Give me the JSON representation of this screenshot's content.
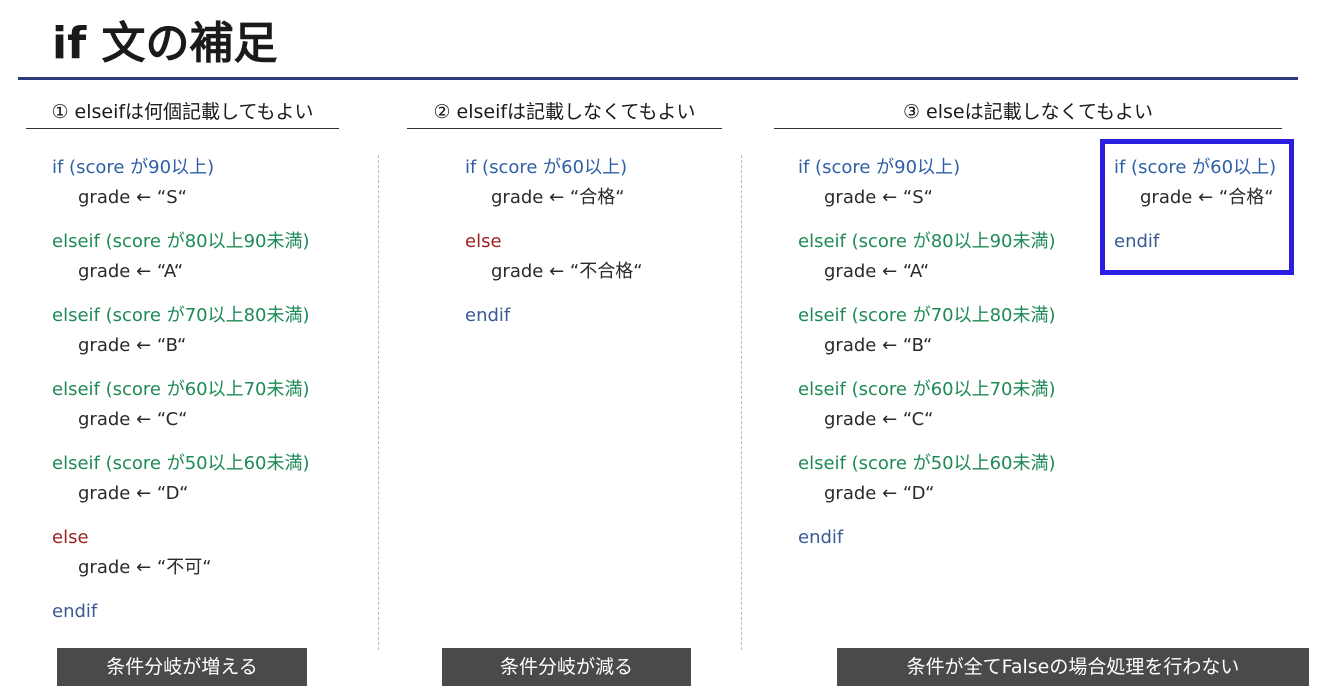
{
  "slide": {
    "title": "if 文の補足"
  },
  "columns": [
    {
      "header": "① elseifは何個記載してもよい",
      "footer": "条件分岐が増える",
      "lines": [
        {
          "kind": "if",
          "text": "if (score が90以上)"
        },
        {
          "kind": "stmt",
          "text": "grade ← “S“"
        },
        {
          "kind": "elseif",
          "text": "elseif (score が80以上90未満)"
        },
        {
          "kind": "stmt",
          "text": "grade ← “A“"
        },
        {
          "kind": "elseif",
          "text": "elseif (score が70以上80未満)"
        },
        {
          "kind": "stmt",
          "text": "grade ← “B“"
        },
        {
          "kind": "elseif",
          "text": "elseif (score が60以上70未満)"
        },
        {
          "kind": "stmt",
          "text": "grade ← “C“"
        },
        {
          "kind": "elseif",
          "text": "elseif (score が50以上60未満)"
        },
        {
          "kind": "stmt",
          "text": "grade ← “D“"
        },
        {
          "kind": "else",
          "text": "else"
        },
        {
          "kind": "stmt",
          "text": "grade ← “不可“"
        },
        {
          "kind": "endif",
          "text": "endif"
        }
      ]
    },
    {
      "header": "② elseifは記載しなくてもよい",
      "footer": "条件分岐が減る",
      "lines": [
        {
          "kind": "if",
          "text": "if (score が60以上)"
        },
        {
          "kind": "stmt",
          "text": "grade ← “合格“"
        },
        {
          "kind": "else",
          "text": "else"
        },
        {
          "kind": "stmt",
          "text": "grade ← “不合格“"
        },
        {
          "kind": "endif",
          "text": "endif"
        }
      ]
    },
    {
      "header": "③ elseは記載しなくてもよい",
      "footer": "条件が全てFalseの場合処理を行わない",
      "lines": [
        {
          "kind": "if",
          "text": "if (score が90以上)"
        },
        {
          "kind": "stmt",
          "text": "grade ← “S“"
        },
        {
          "kind": "elseif",
          "text": "elseif (score が80以上90未満)"
        },
        {
          "kind": "stmt",
          "text": "grade ← “A“"
        },
        {
          "kind": "elseif",
          "text": "elseif (score が70以上80未満)"
        },
        {
          "kind": "stmt",
          "text": "grade ← “B“"
        },
        {
          "kind": "elseif",
          "text": "elseif (score が60以上70未満)"
        },
        {
          "kind": "stmt",
          "text": "grade ← “C“"
        },
        {
          "kind": "elseif",
          "text": "elseif (score が50以上60未満)"
        },
        {
          "kind": "stmt",
          "text": "grade ← “D“"
        },
        {
          "kind": "endif",
          "text": "endif"
        }
      ],
      "highlight_lines": [
        {
          "kind": "if",
          "text": "if (score が60以上)"
        },
        {
          "kind": "stmt",
          "text": "grade ← “合格“"
        },
        {
          "kind": "endif",
          "text": "endif"
        }
      ]
    }
  ],
  "colors": {
    "if": "#2e60a8",
    "elseif": "#1e8a55",
    "else": "#9b2222",
    "endif": "#3a5a94",
    "title_rule": "#2f3b7c",
    "highlight_border": "#2a1fe0",
    "footer_bg": "#4a4a4a"
  }
}
